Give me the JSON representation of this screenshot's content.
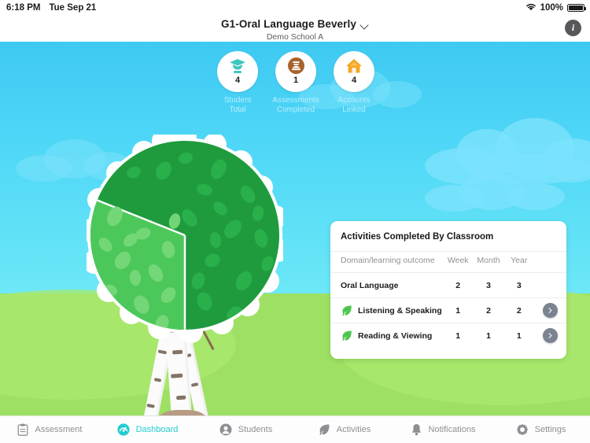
{
  "status_bar": {
    "time": "6:18 PM",
    "date": "Tue Sep 21",
    "battery_percent": "100%",
    "wifi_icon": "wifi-icon",
    "battery_icon": "battery-full-icon"
  },
  "header": {
    "title": "G1-Oral Language Beverly",
    "subtitle": "Demo School A",
    "chevron_icon": "chevron-down-icon",
    "info_label": "i"
  },
  "scene": {
    "tree_label": "Classroom Tree",
    "sky_color": "#4fd7f7",
    "grass_color": "#9ee063",
    "canopy_dark": "#25a244",
    "canopy_light": "#4cc85a"
  },
  "stats": [
    {
      "icon": "student-cap-icon",
      "value": "4",
      "caption_line1": "Student",
      "caption_line2": "Total",
      "color": "#3fc6bd"
    },
    {
      "icon": "assessment-book-icon",
      "value": "1",
      "caption_line1": "Assessments",
      "caption_line2": "Completed",
      "color": "#a8622a"
    },
    {
      "icon": "home-icon",
      "value": "4",
      "caption_line1": "Accounts",
      "caption_line2": "Linked",
      "color": "#f5a623"
    }
  ],
  "card": {
    "title": "Activities Completed By Classroom",
    "columns": [
      "Domain/learning outcome",
      "Week",
      "Month",
      "Year"
    ],
    "rows": [
      {
        "name": "Oral Language",
        "week": "2",
        "month": "3",
        "year": "3",
        "leaf": false,
        "action": false
      },
      {
        "name": "Listening & Speaking",
        "week": "1",
        "month": "2",
        "year": "2",
        "leaf": true,
        "action": true
      },
      {
        "name": "Reading & Viewing",
        "week": "1",
        "month": "1",
        "year": "1",
        "leaf": true,
        "action": true
      }
    ],
    "action_icon": "chevron-right-icon",
    "leaf_icon": "leaf-icon",
    "action_button_color": "#7b8391"
  },
  "tabbar": {
    "active_color": "#22cdd1",
    "inactive_color": "#8d8f93",
    "items": [
      {
        "label": "Assessment",
        "icon": "clipboard-icon",
        "active": false
      },
      {
        "label": "Dashboard",
        "icon": "gauge-icon",
        "active": true
      },
      {
        "label": "Students",
        "icon": "student-icon",
        "active": false
      },
      {
        "label": "Activities",
        "icon": "leaf-icon",
        "active": false
      },
      {
        "label": "Notifications",
        "icon": "bell-icon",
        "active": false
      },
      {
        "label": "Settings",
        "icon": "gear-icon",
        "active": false
      }
    ]
  }
}
